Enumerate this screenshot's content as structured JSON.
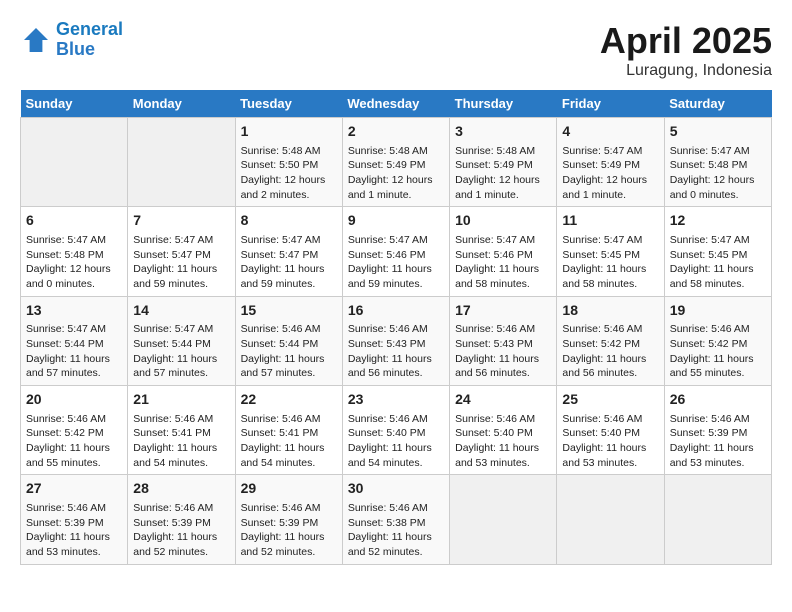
{
  "logo": {
    "line1": "General",
    "line2": "Blue"
  },
  "title": "April 2025",
  "subtitle": "Luragung, Indonesia",
  "weekdays": [
    "Sunday",
    "Monday",
    "Tuesday",
    "Wednesday",
    "Thursday",
    "Friday",
    "Saturday"
  ],
  "weeks": [
    [
      {
        "day": null
      },
      {
        "day": null
      },
      {
        "day": "1",
        "sunrise": "5:48 AM",
        "sunset": "5:50 PM",
        "daylight": "12 hours and 2 minutes."
      },
      {
        "day": "2",
        "sunrise": "5:48 AM",
        "sunset": "5:49 PM",
        "daylight": "12 hours and 1 minute."
      },
      {
        "day": "3",
        "sunrise": "5:48 AM",
        "sunset": "5:49 PM",
        "daylight": "12 hours and 1 minute."
      },
      {
        "day": "4",
        "sunrise": "5:47 AM",
        "sunset": "5:49 PM",
        "daylight": "12 hours and 1 minute."
      },
      {
        "day": "5",
        "sunrise": "5:47 AM",
        "sunset": "5:48 PM",
        "daylight": "12 hours and 0 minutes."
      }
    ],
    [
      {
        "day": "6",
        "sunrise": "5:47 AM",
        "sunset": "5:48 PM",
        "daylight": "12 hours and 0 minutes."
      },
      {
        "day": "7",
        "sunrise": "5:47 AM",
        "sunset": "5:47 PM",
        "daylight": "11 hours and 59 minutes."
      },
      {
        "day": "8",
        "sunrise": "5:47 AM",
        "sunset": "5:47 PM",
        "daylight": "11 hours and 59 minutes."
      },
      {
        "day": "9",
        "sunrise": "5:47 AM",
        "sunset": "5:46 PM",
        "daylight": "11 hours and 59 minutes."
      },
      {
        "day": "10",
        "sunrise": "5:47 AM",
        "sunset": "5:46 PM",
        "daylight": "11 hours and 58 minutes."
      },
      {
        "day": "11",
        "sunrise": "5:47 AM",
        "sunset": "5:45 PM",
        "daylight": "11 hours and 58 minutes."
      },
      {
        "day": "12",
        "sunrise": "5:47 AM",
        "sunset": "5:45 PM",
        "daylight": "11 hours and 58 minutes."
      }
    ],
    [
      {
        "day": "13",
        "sunrise": "5:47 AM",
        "sunset": "5:44 PM",
        "daylight": "11 hours and 57 minutes."
      },
      {
        "day": "14",
        "sunrise": "5:47 AM",
        "sunset": "5:44 PM",
        "daylight": "11 hours and 57 minutes."
      },
      {
        "day": "15",
        "sunrise": "5:46 AM",
        "sunset": "5:44 PM",
        "daylight": "11 hours and 57 minutes."
      },
      {
        "day": "16",
        "sunrise": "5:46 AM",
        "sunset": "5:43 PM",
        "daylight": "11 hours and 56 minutes."
      },
      {
        "day": "17",
        "sunrise": "5:46 AM",
        "sunset": "5:43 PM",
        "daylight": "11 hours and 56 minutes."
      },
      {
        "day": "18",
        "sunrise": "5:46 AM",
        "sunset": "5:42 PM",
        "daylight": "11 hours and 56 minutes."
      },
      {
        "day": "19",
        "sunrise": "5:46 AM",
        "sunset": "5:42 PM",
        "daylight": "11 hours and 55 minutes."
      }
    ],
    [
      {
        "day": "20",
        "sunrise": "5:46 AM",
        "sunset": "5:42 PM",
        "daylight": "11 hours and 55 minutes."
      },
      {
        "day": "21",
        "sunrise": "5:46 AM",
        "sunset": "5:41 PM",
        "daylight": "11 hours and 54 minutes."
      },
      {
        "day": "22",
        "sunrise": "5:46 AM",
        "sunset": "5:41 PM",
        "daylight": "11 hours and 54 minutes."
      },
      {
        "day": "23",
        "sunrise": "5:46 AM",
        "sunset": "5:40 PM",
        "daylight": "11 hours and 54 minutes."
      },
      {
        "day": "24",
        "sunrise": "5:46 AM",
        "sunset": "5:40 PM",
        "daylight": "11 hours and 53 minutes."
      },
      {
        "day": "25",
        "sunrise": "5:46 AM",
        "sunset": "5:40 PM",
        "daylight": "11 hours and 53 minutes."
      },
      {
        "day": "26",
        "sunrise": "5:46 AM",
        "sunset": "5:39 PM",
        "daylight": "11 hours and 53 minutes."
      }
    ],
    [
      {
        "day": "27",
        "sunrise": "5:46 AM",
        "sunset": "5:39 PM",
        "daylight": "11 hours and 53 minutes."
      },
      {
        "day": "28",
        "sunrise": "5:46 AM",
        "sunset": "5:39 PM",
        "daylight": "11 hours and 52 minutes."
      },
      {
        "day": "29",
        "sunrise": "5:46 AM",
        "sunset": "5:39 PM",
        "daylight": "11 hours and 52 minutes."
      },
      {
        "day": "30",
        "sunrise": "5:46 AM",
        "sunset": "5:38 PM",
        "daylight": "11 hours and 52 minutes."
      },
      {
        "day": null
      },
      {
        "day": null
      },
      {
        "day": null
      }
    ]
  ],
  "labels": {
    "sunrise": "Sunrise:",
    "sunset": "Sunset:",
    "daylight": "Daylight:"
  }
}
